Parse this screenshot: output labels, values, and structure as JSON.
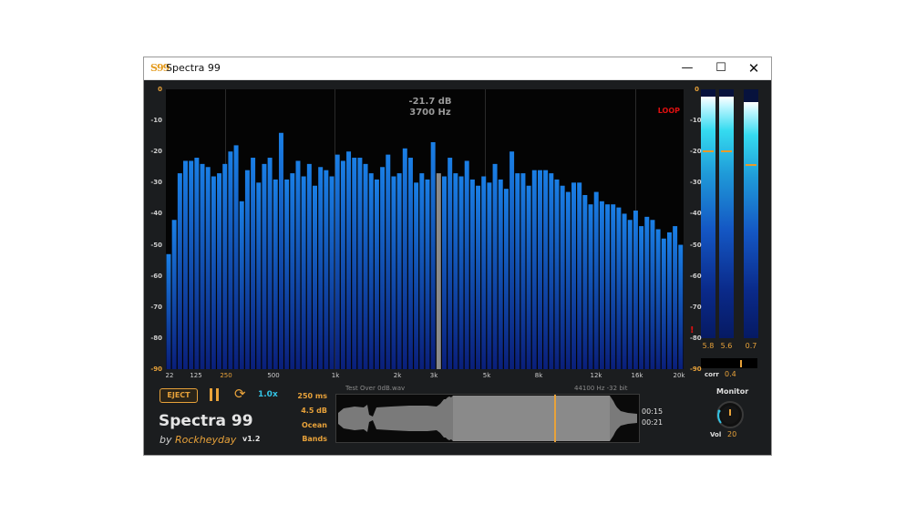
{
  "window": {
    "title": "Spectra 99",
    "icon_text": "S99",
    "controls": {
      "minimize": "—",
      "maximize": "☐",
      "close": "✕"
    }
  },
  "spectrum": {
    "readout_db": "-21.7 dB",
    "readout_hz": "3700 Hz",
    "loop_label": "LOOP",
    "y_labels": [
      "0",
      "-10",
      "-20",
      "-30",
      "-40",
      "-50",
      "-60",
      "-70",
      "-80",
      "-90"
    ],
    "x_labels": [
      "22",
      "125",
      "250",
      "500",
      "1k",
      "2k",
      "3k",
      "5k",
      "8k",
      "12k",
      "16k",
      "20k"
    ],
    "bar_levels_db": [
      -53,
      -42,
      -27,
      -23,
      -23,
      -22,
      -24,
      -25,
      -28,
      -27,
      -24,
      -20,
      -18,
      -36,
      -26,
      -22,
      -30,
      -24,
      -22,
      -29,
      -14,
      -29,
      -27,
      -23,
      -28,
      -24,
      -31,
      -25,
      -26,
      -28,
      -21,
      -23,
      -20,
      -22,
      -22,
      -24,
      -27,
      -29,
      -25,
      -21,
      -28,
      -27,
      -19,
      -22,
      -30,
      -27,
      -29,
      -17,
      -27,
      -28,
      -22,
      -27,
      -28,
      -23,
      -29,
      -31,
      -28,
      -30,
      -24,
      -29,
      -32,
      -20,
      -27,
      -27,
      -31,
      -26,
      -26,
      -26,
      -27,
      -29,
      -31,
      -33,
      -30,
      -30,
      -34,
      -37,
      -33,
      -36,
      -37,
      -37,
      -38,
      -40,
      -42,
      -39,
      -44,
      -41,
      -42,
      -45,
      -48,
      -46,
      -44,
      -50
    ],
    "cursor_bar_index": 48,
    "colors": {
      "bar_top": "#1a7fe6",
      "bar_bottom": "#0a1f7a",
      "cursor": "#8a8a8a",
      "loop": "#e01010"
    }
  },
  "meters": {
    "left": {
      "level": 0.97,
      "peak_db": -22,
      "value": "5.8"
    },
    "right": {
      "level": 0.97,
      "peak_db": -22,
      "value": "5.6"
    },
    "side": {
      "level": 0.95,
      "peak_db": -27,
      "value": "0.7"
    },
    "warn_icon": "!",
    "axis_labels": [
      "0",
      "-10",
      "-20",
      "-30",
      "-40",
      "-50",
      "-60",
      "-70",
      "-80",
      "-90"
    ],
    "corr_label": "corr",
    "corr_value": "0.4"
  },
  "transport": {
    "eject_label": "EJECT",
    "pause_icon": "pause-icon",
    "loop_icon": "loop-icon",
    "speed": "1.0x"
  },
  "branding": {
    "app_name": "Spectra 99",
    "by": "by",
    "org": "Rockheyday",
    "version": "v1.2"
  },
  "settings": {
    "window_ms": "250 ms",
    "slope": "4.5 dB",
    "scheme": "Ocean",
    "mode": "Bands"
  },
  "file": {
    "name": "Test Over 0dB.wav",
    "info": "44100 Hz -32 bit",
    "time_total": "00:15",
    "time_pos": "00:21",
    "playhead_fraction": 0.72
  },
  "monitor": {
    "title": "Monitor",
    "vol_label": "Vol",
    "vol_value": "20"
  }
}
